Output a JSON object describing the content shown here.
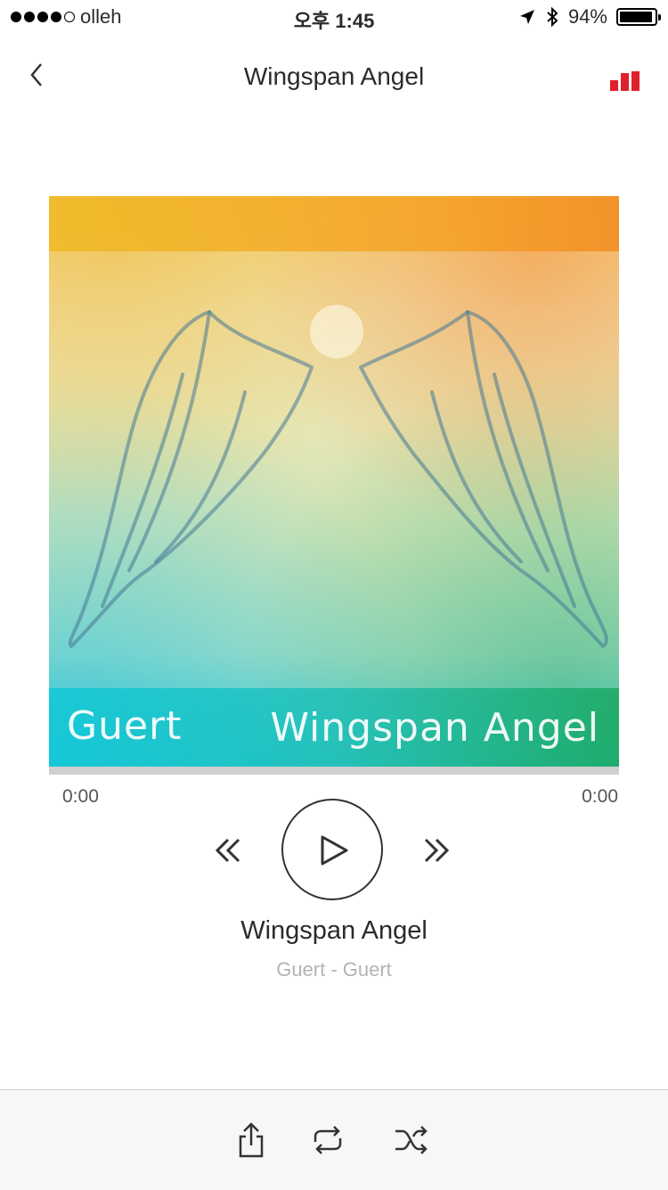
{
  "status_bar": {
    "carrier": "olleh",
    "time": "오후 1:45",
    "battery": "94%",
    "battery_level": 0.94,
    "signal_bars": 4
  },
  "nav": {
    "title": "Wingspan Angel",
    "back_icon": "chevron-left-icon",
    "now_playing_icon": "equalizer-icon",
    "accent_color": "#e0202a"
  },
  "album_art": {
    "artist": "Guert",
    "title": "Wingspan Angel"
  },
  "player": {
    "elapsed": "0:00",
    "duration": "0:00",
    "progress": 0
  },
  "track": {
    "title": "Wingspan Angel",
    "subtitle": "Guert - Guert"
  },
  "toolbar": {
    "icons": [
      "share-icon",
      "repeat-icon",
      "shuffle-icon"
    ]
  }
}
